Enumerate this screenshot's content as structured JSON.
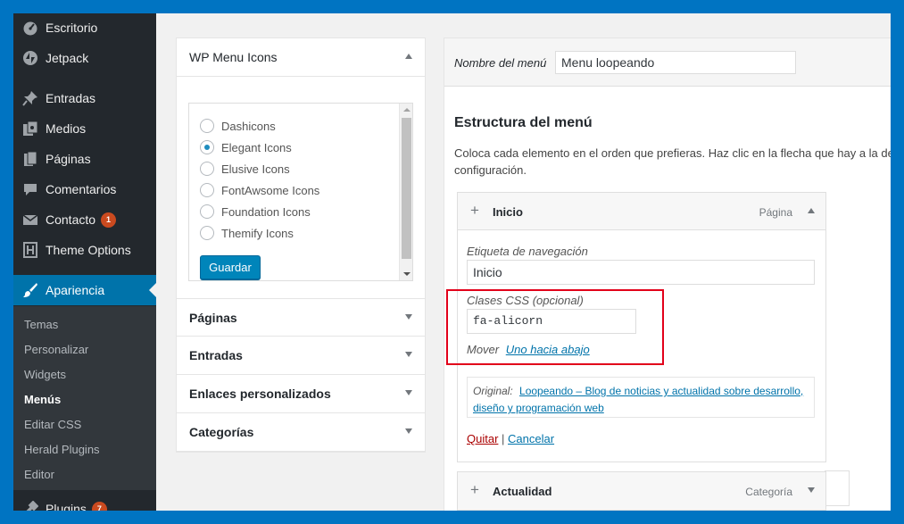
{
  "sidebar": {
    "items": [
      {
        "label": "Escritorio",
        "icon": "dashboard-icon"
      },
      {
        "label": "Jetpack",
        "icon": "jetpack-icon"
      },
      {
        "label": "Entradas",
        "icon": "pin-icon"
      },
      {
        "label": "Medios",
        "icon": "media-icon"
      },
      {
        "label": "Páginas",
        "icon": "pages-icon"
      },
      {
        "label": "Comentarios",
        "icon": "comments-icon"
      },
      {
        "label": "Contacto",
        "icon": "mail-icon",
        "badge": "1"
      },
      {
        "label": "Theme Options",
        "icon": "h-logo-icon"
      },
      {
        "label": "Apariencia",
        "icon": "brush-icon"
      },
      {
        "label": "Plugins",
        "icon": "plugin-icon",
        "badge": "7"
      }
    ],
    "submenu": [
      "Temas",
      "Personalizar",
      "Widgets",
      "Menús",
      "Editar CSS",
      "Herald Plugins",
      "Editor"
    ]
  },
  "accordion": {
    "open_title": "WP Menu Icons",
    "icon_sets": [
      "Dashicons",
      "Elegant Icons",
      "Elusive Icons",
      "FontAwsome Icons",
      "Foundation Icons",
      "Themify Icons"
    ],
    "selected_icon_set": "Elegant Icons",
    "save_label": "Guardar",
    "sections": [
      "Páginas",
      "Entradas",
      "Enlaces personalizados",
      "Categorías"
    ]
  },
  "editor": {
    "menu_name_label": "Nombre del menú",
    "menu_name_value": "Menu loopeando",
    "structure_title": "Estructura del menú",
    "structure_desc_line1": "Coloca cada elemento en el orden que prefieras. Haz clic en la flecha que hay a la dere",
    "structure_desc_line2": "configuración.",
    "item": {
      "title": "Inicio",
      "type": "Página",
      "nav_label": "Etiqueta de navegación",
      "nav_value": "Inicio",
      "css_label": "Clases CSS (opcional)",
      "css_value": "fa-alicorn",
      "move_label": "Mover",
      "move_link": "Uno hacia abajo",
      "original_label": "Original:",
      "original_link_line1": "Loopeando – Blog de noticias y actualidad sobre desarrollo,",
      "original_link_line2": "diseño y programación web",
      "remove_label": "Quitar",
      "separator": "|",
      "cancel_label": "Cancelar"
    },
    "item2": {
      "title": "Actualidad",
      "type": "Categoría"
    }
  },
  "colors": {
    "accent": "#0073aa",
    "highlight": "#e2001a",
    "frame": "#0074c2"
  }
}
